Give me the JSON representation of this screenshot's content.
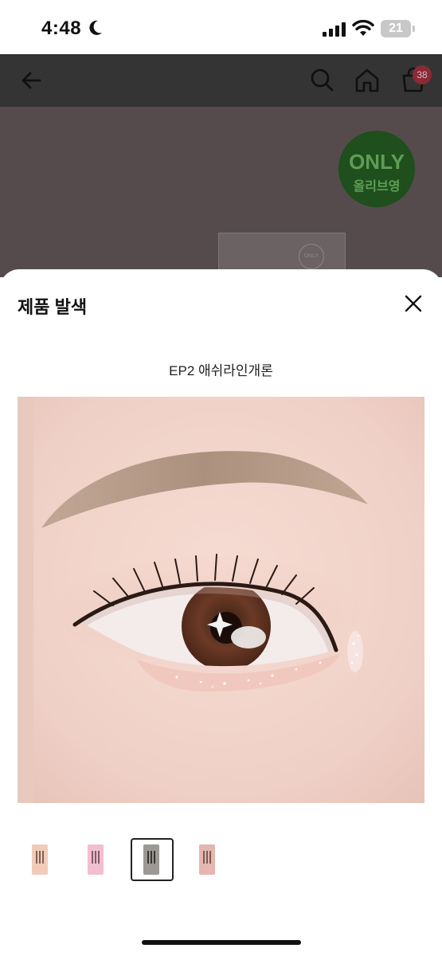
{
  "status": {
    "time": "4:48",
    "battery": "21"
  },
  "header": {
    "cart_count": "38"
  },
  "hero": {
    "badge_line1": "ONLY",
    "badge_line2": "올리브영",
    "box_seal": "ONLY"
  },
  "sheet": {
    "title": "제품 발색",
    "shade_name": "EP2 애쉬라인개론",
    "selected_thumbnail_index": 3,
    "thumbnails": [
      {
        "label": "shade 1",
        "color": "#f2cbb8"
      },
      {
        "label": "shade 2",
        "color": "#f1bfd2"
      },
      {
        "label": "shade 3",
        "color": "#9c9894"
      },
      {
        "label": "shade 4",
        "color": "#e4b7b0"
      }
    ]
  },
  "colors": {
    "overlay": "#3a3a3a",
    "badge_green": "#1f4f1c",
    "cart_badge": "#8a2a36"
  }
}
